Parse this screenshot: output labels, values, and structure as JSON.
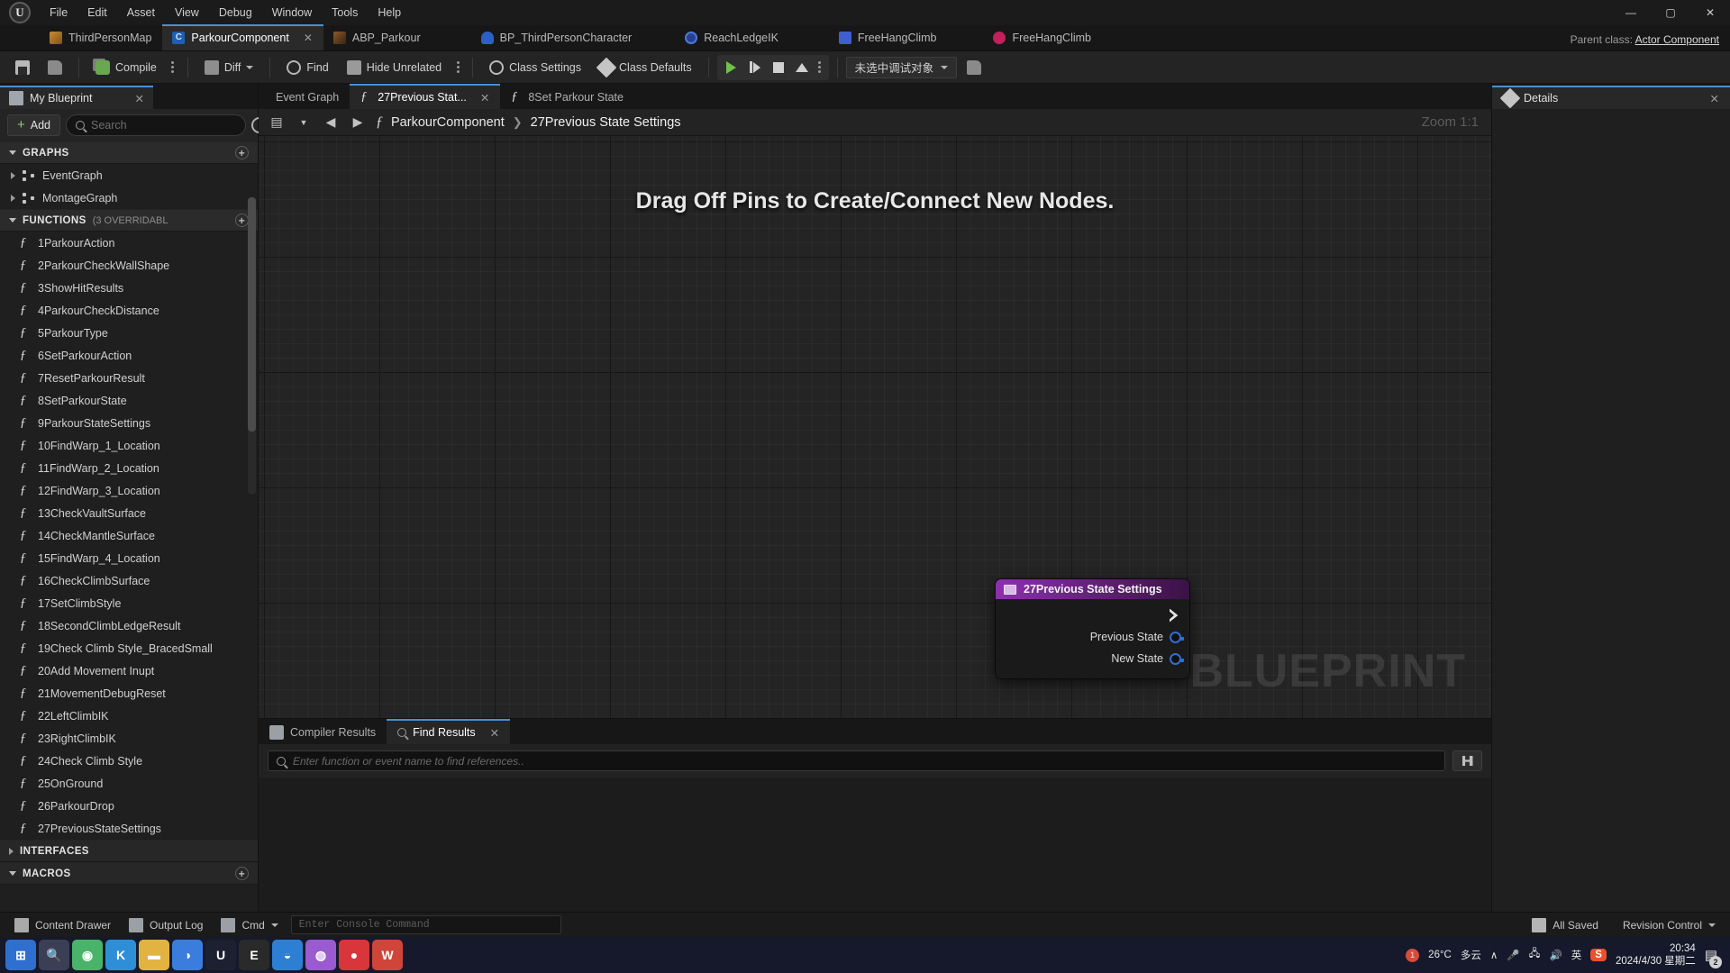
{
  "window": {
    "logo_glyph": "U",
    "menu": [
      "File",
      "Edit",
      "Asset",
      "View",
      "Debug",
      "Window",
      "Tools",
      "Help"
    ],
    "controls": {
      "minimize": "—",
      "maximize": "▢",
      "close": "✕"
    }
  },
  "asset_tabs": [
    {
      "label": "ThirdPersonMap",
      "icon": "map-icon",
      "active": false,
      "closable": false
    },
    {
      "label": "ParkourComponent",
      "icon": "blueprint-class-icon",
      "active": true,
      "closable": true,
      "close": "✕"
    },
    {
      "label": "ABP_Parkour",
      "icon": "anim-blueprint-icon",
      "active": false,
      "closable": false
    },
    {
      "label": "BP_ThirdPersonCharacter",
      "icon": "character-blueprint-icon",
      "active": false,
      "closable": false
    },
    {
      "label": "ReachLedgeIK",
      "icon": "ik-icon",
      "active": false,
      "closable": false
    },
    {
      "label": "FreeHangClimb",
      "icon": "anim-sequence-icon",
      "active": false,
      "closable": false
    },
    {
      "label": "FreeHangClimb",
      "icon": "anim-montage-icon",
      "active": false,
      "closable": false
    }
  ],
  "parent_class": {
    "label": "Parent class:",
    "value": "Actor Component"
  },
  "toolbar": {
    "save_tooltip": "Save",
    "browse_tooltip": "Browse",
    "compile_label": "Compile",
    "diff_label": "Diff",
    "find_label": "Find",
    "hide_unrelated_label": "Hide Unrelated",
    "class_settings_label": "Class Settings",
    "class_defaults_label": "Class Defaults",
    "play_label": "Play",
    "step_label": "Step",
    "stop_label": "Stop",
    "eject_label": "Eject",
    "debug_object": "未选中调试对象"
  },
  "my_blueprint": {
    "tab_label": "My Blueprint",
    "tab_close": "✕",
    "add_label": "Add",
    "search_placeholder": "Search",
    "search_value": "",
    "graphs_section": {
      "title": "GRAPHS",
      "add": "+"
    },
    "graphs": [
      {
        "label": "EventGraph"
      },
      {
        "label": "MontageGraph"
      }
    ],
    "functions_section": {
      "title": "FUNCTIONS",
      "sub": "(3 OVERRIDABL",
      "add": "+"
    },
    "functions": [
      {
        "label": "1ParkourAction"
      },
      {
        "label": "2ParkourCheckWallShape"
      },
      {
        "label": "3ShowHitResults"
      },
      {
        "label": "4ParkourCheckDistance"
      },
      {
        "label": "5ParkourType"
      },
      {
        "label": "6SetParkourAction"
      },
      {
        "label": "7ResetParkourResult"
      },
      {
        "label": "8SetParkourState"
      },
      {
        "label": "9ParkourStateSettings"
      },
      {
        "label": "10FindWarp_1_Location"
      },
      {
        "label": "11FindWarp_2_Location"
      },
      {
        "label": "12FindWarp_3_Location"
      },
      {
        "label": "13CheckVaultSurface"
      },
      {
        "label": "14CheckMantleSurface"
      },
      {
        "label": "15FindWarp_4_Location"
      },
      {
        "label": "16CheckClimbSurface"
      },
      {
        "label": "17SetClimbStyle"
      },
      {
        "label": "18SecondClimbLedgeResult"
      },
      {
        "label": "19Check Climb Style_BracedSmall"
      },
      {
        "label": "20Add Movement Inupt"
      },
      {
        "label": "21MovementDebugReset"
      },
      {
        "label": "22LeftClimbIK"
      },
      {
        "label": "23RightClimbIK"
      },
      {
        "label": "24Check Climb Style"
      },
      {
        "label": "25OnGround"
      },
      {
        "label": "26ParkourDrop"
      },
      {
        "label": "27PreviousStateSettings"
      }
    ],
    "interfaces_section": {
      "title": "INTERFACES"
    },
    "macros_section": {
      "title": "MACROS",
      "add": "+"
    }
  },
  "graph_tabs": [
    {
      "label": "Event Graph",
      "icon": "event-graph-icon",
      "active": false,
      "closable": false
    },
    {
      "label": "27Previous Stat...",
      "icon": "function-icon",
      "active": true,
      "closable": true,
      "close": "✕"
    },
    {
      "label": "8Set Parkour State",
      "icon": "function-icon",
      "active": false,
      "closable": false
    }
  ],
  "breadcrumb": {
    "back": "◀",
    "forward": "▶",
    "function_glyph": "f",
    "root": "ParkourComponent",
    "separator": "❯",
    "current": "27Previous State Settings",
    "zoom_label": "Zoom 1:1"
  },
  "graph": {
    "hint": "Drag Off Pins to Create/Connect New Nodes.",
    "watermark": "BLUEPRINT",
    "node": {
      "title": "27Previous State Settings",
      "exec_out": "",
      "pins": [
        {
          "label": "Previous State",
          "type": "data"
        },
        {
          "label": "New State",
          "type": "data"
        }
      ]
    }
  },
  "bottom_dock": {
    "tabs": [
      {
        "label": "Compiler Results",
        "icon": "compiler-results-icon",
        "active": false,
        "closable": false
      },
      {
        "label": "Find Results",
        "icon": "search-icon",
        "active": true,
        "closable": true,
        "close": "✕"
      }
    ],
    "find_placeholder": "Enter function or event name to find references..",
    "find_value": ""
  },
  "details": {
    "tab_label": "Details",
    "tab_close": "✕"
  },
  "status_bar": {
    "content_drawer": "Content Drawer",
    "output_log": "Output Log",
    "cmd_label": "Cmd",
    "cmd_placeholder": "Enter Console Command",
    "cmd_value": "",
    "all_saved": "All Saved",
    "revision_control": "Revision Control"
  },
  "taskbar": {
    "items": [
      {
        "name": "start-button",
        "glyph": "⊞",
        "color": "#2f6fd0"
      },
      {
        "name": "search-button",
        "glyph": "🔍",
        "color": "#3a3f55"
      },
      {
        "name": "chrome-icon",
        "glyph": "◉",
        "color": "#49b36a"
      },
      {
        "name": "kugou-icon",
        "glyph": "K",
        "color": "#2f8fd6"
      },
      {
        "name": "explorer-icon",
        "glyph": "▬",
        "color": "#e3b341"
      },
      {
        "name": "firefox-icon",
        "glyph": "◑",
        "color": "#3b7ddd"
      },
      {
        "name": "unreal-editor-icon",
        "glyph": "U",
        "color": "#1d2030"
      },
      {
        "name": "epic-games-icon",
        "glyph": "E",
        "color": "#2a2a2a"
      },
      {
        "name": "edge-icon",
        "glyph": "◒",
        "color": "#2d7fd3"
      },
      {
        "name": "pie-app-icon",
        "glyph": "◍",
        "color": "#9a5ad0"
      },
      {
        "name": "recorder-icon",
        "glyph": "●",
        "color": "#d8363a"
      },
      {
        "name": "wps-icon",
        "glyph": "W",
        "color": "#d0453a"
      }
    ],
    "tray": {
      "chevron": "∧",
      "mic": "🎤",
      "network": "🖧",
      "volume": "🔊",
      "ime": "英",
      "sogou": "S",
      "time": "20:34",
      "date": "2024/4/30 星期二",
      "notifications": "2"
    },
    "weather": {
      "temp": "26°C",
      "desc": "多云",
      "alert": "1"
    }
  }
}
